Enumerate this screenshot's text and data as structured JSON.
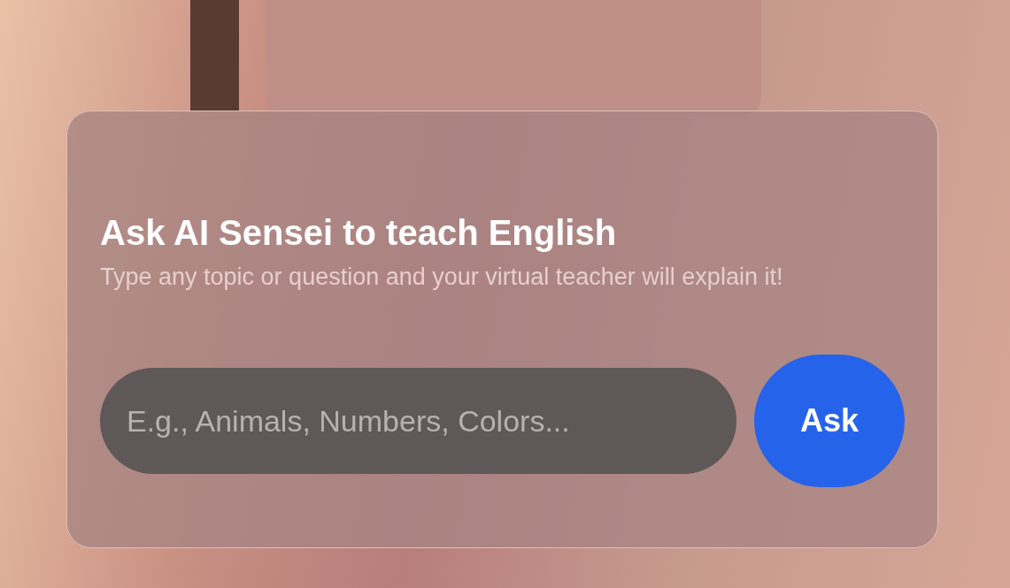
{
  "card": {
    "title": "Ask AI Sensei to teach English",
    "subtitle": "Type any topic or question and your virtual teacher will explain it!",
    "input": {
      "placeholder": "E.g., Animals, Numbers, Colors..."
    },
    "button": {
      "label": "Ask"
    }
  }
}
